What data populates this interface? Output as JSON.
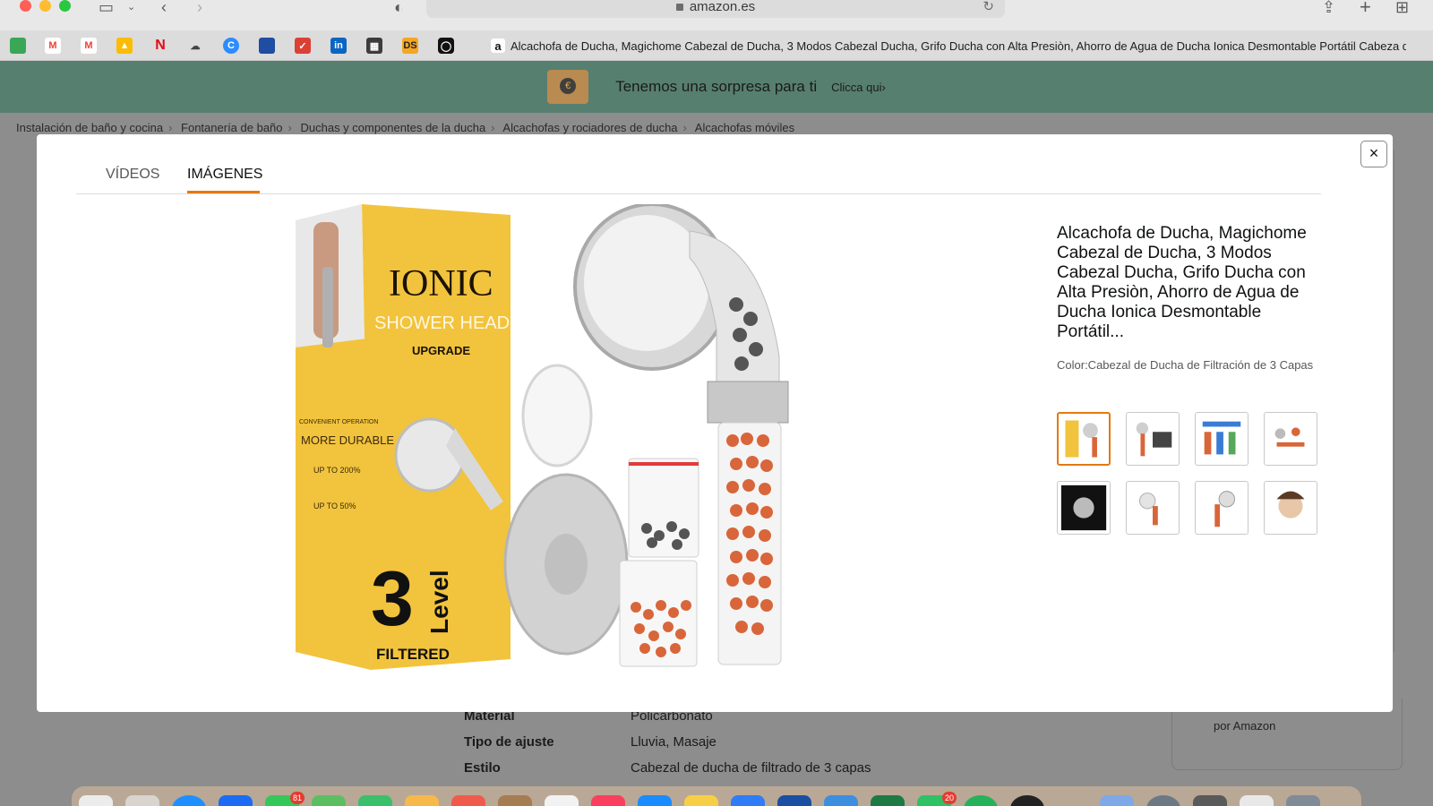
{
  "browser": {
    "url": "amazon.es",
    "tab_title": "Alcachofa de Ducha, Magichome Cabezal de Ducha, 3 Modos Cabezal Ducha, Grifo Ducha con Alta Presiòn, Ahorro de Agua de Ducha Ionica Desmontable Portátil Cabeza de...",
    "bookmark_icons": [
      "calendar-icon",
      "gmail-icon",
      "gmail-icon",
      "drive-icon",
      "netflix-icon",
      "cloud-icon",
      "canva-icon",
      "bookmark-blue-icon",
      "todoist-icon",
      "linkedin-icon",
      "sheet-icon",
      "ds-icon",
      "github-icon"
    ],
    "ds_label": "DS"
  },
  "promo": {
    "text": "Tenemos una sorpresa para ti",
    "link": "Clicca qui›"
  },
  "breadcrumb": [
    "Instalación de baño y cocina",
    "Fontanería de baño",
    "Duchas y componentes de la ducha",
    "Alcachofas y rociadores de ducha",
    "Alcachofas móviles"
  ],
  "specs": [
    {
      "label": "Material",
      "value": "Policarbonato"
    },
    {
      "label": "Tipo de ajuste",
      "value": "Lluvia, Masaje"
    },
    {
      "label": "Estilo",
      "value": "Cabezal de ducha de filtrado de 3 capas"
    }
  ],
  "side_text": "por Amazon",
  "modal": {
    "tabs": [
      "VÍDEOS",
      "IMÁGENES"
    ],
    "active_tab": "IMÁGENES",
    "close_label": "×",
    "title": "Alcachofa de Ducha, Magichome Cabezal de Ducha, 3 Modos Cabezal Ducha, Grifo Ducha con Alta Presiòn, Ahorro de Agua de Ducha Ionica Desmontable Portátil...",
    "color_text": "Color:Cabezal de Ducha de Filtración de 3 Capas",
    "box": {
      "brand": "IONIC",
      "subtitle": "SHOWER HEAD",
      "upgrade": "UPGRADE",
      "convenient": "CONVENIENT OPERATION",
      "durable": "MORE DURABLE",
      "up200": "UP TO 200%",
      "up50": "UP TO 50%",
      "number": "3",
      "level": "Level",
      "filtered": "FILTERED"
    },
    "thumbnail_count": 8,
    "selected_thumbnail": 1
  },
  "dock": {
    "badges": [
      "81",
      "20"
    ]
  },
  "colors": {
    "accent": "#e47911",
    "promo_bg": "#577f6f",
    "box_yellow": "#f2c33c",
    "beads": "#d8663a"
  }
}
